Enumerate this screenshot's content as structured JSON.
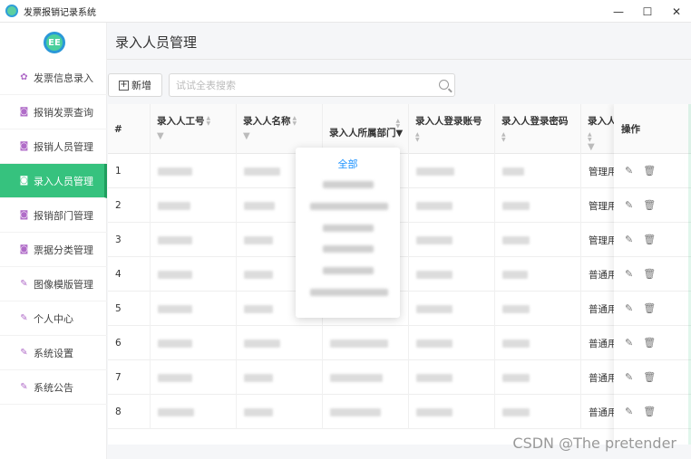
{
  "window": {
    "title": "发票报销记录系统",
    "minimize": "—",
    "maximize": "☐",
    "close": "✕"
  },
  "logo": {
    "text": "EE"
  },
  "sidebar": {
    "items": [
      {
        "label": "发票信息录入",
        "icon": "pinwheel-icon"
      },
      {
        "label": "报销发票查询",
        "icon": "camera-icon"
      },
      {
        "label": "报销人员管理",
        "icon": "camera-icon"
      },
      {
        "label": "录入人员管理",
        "icon": "camera-icon",
        "active": true
      },
      {
        "label": "报销部门管理",
        "icon": "camera-icon"
      },
      {
        "label": "票据分类管理",
        "icon": "camera-icon"
      },
      {
        "label": "图像模版管理",
        "icon": "pencil-icon"
      },
      {
        "label": "个人中心",
        "icon": "pencil-icon"
      },
      {
        "label": "系统设置",
        "icon": "pencil-icon"
      },
      {
        "label": "系统公告",
        "icon": "pencil-icon"
      }
    ]
  },
  "page": {
    "title": "录入人员管理"
  },
  "toolbar": {
    "add_label": "新增",
    "search_placeholder": "试试全表搜索"
  },
  "table": {
    "columns": [
      "#",
      "录入人工号",
      "录入人名称",
      "录入人所属部门",
      "录入人登录账号",
      "录入人登录密码",
      "录入人",
      "操作"
    ],
    "rows": [
      {
        "index": "1",
        "role": "管理用"
      },
      {
        "index": "2",
        "role": "管理用"
      },
      {
        "index": "3",
        "role": "管理用"
      },
      {
        "index": "4",
        "role": "普通用"
      },
      {
        "index": "5",
        "role": "普通用"
      },
      {
        "index": "6",
        "role": "普通用"
      },
      {
        "index": "7",
        "role": "普通用"
      },
      {
        "index": "8",
        "role": "普通用"
      }
    ]
  },
  "filter_dropdown": {
    "all_label": "全部"
  },
  "watermark": "CSDN @The  pretender",
  "colors": {
    "accent": "#36c27e",
    "link": "#1890ff"
  }
}
